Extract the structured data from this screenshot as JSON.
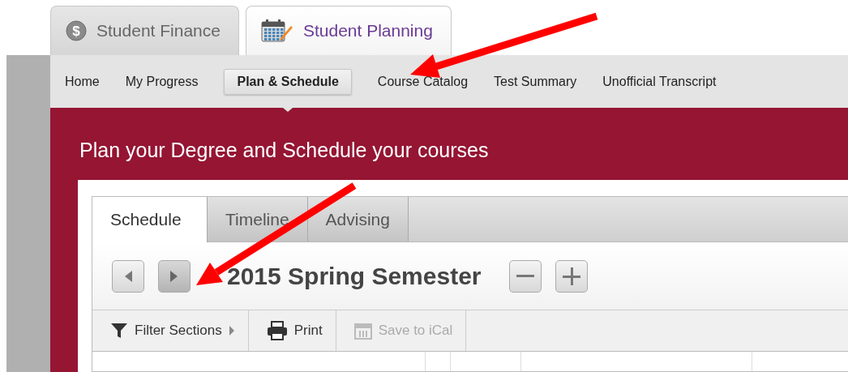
{
  "app_tabs": [
    {
      "label": "Student Finance",
      "selected": false,
      "kind": "finance",
      "icon_text": "$"
    },
    {
      "label": "Student Planning",
      "selected": true,
      "kind": "planning"
    }
  ],
  "nav": [
    {
      "label": "Home",
      "selected": false
    },
    {
      "label": "My Progress",
      "selected": false
    },
    {
      "label": "Plan & Schedule",
      "selected": true
    },
    {
      "label": "Course Catalog",
      "selected": false
    },
    {
      "label": "Test Summary",
      "selected": false
    },
    {
      "label": "Unofficial Transcript",
      "selected": false
    }
  ],
  "banner": {
    "title": "Plan your Degree and Schedule your courses"
  },
  "panel_tabs": [
    {
      "label": "Schedule",
      "selected": true
    },
    {
      "label": "Timeline",
      "selected": false
    },
    {
      "label": "Advising",
      "selected": false
    }
  ],
  "term": {
    "title": "2015 Spring Semester"
  },
  "toolbar": [
    {
      "label": "Filter Sections",
      "kind": "filter",
      "disabled": false
    },
    {
      "label": "Print",
      "kind": "print",
      "disabled": false
    },
    {
      "label": "Save to iCal",
      "kind": "ical",
      "disabled": true
    }
  ]
}
